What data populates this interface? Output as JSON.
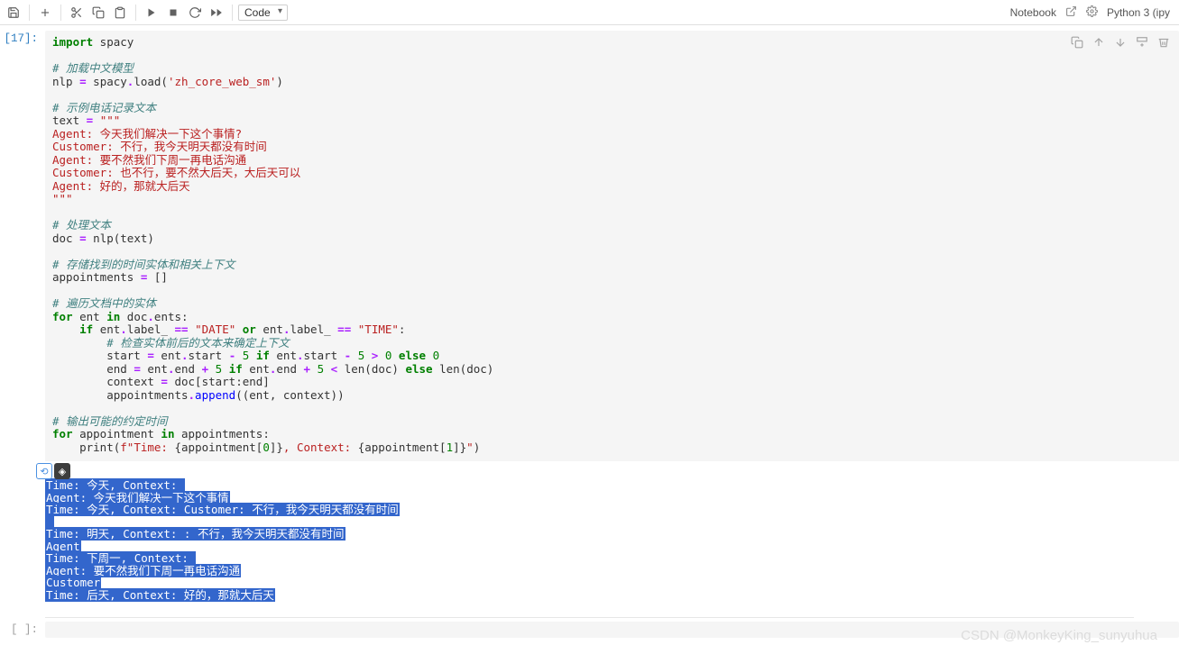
{
  "toolbar": {
    "cell_type": "Code",
    "notebook_label": "Notebook",
    "kernel_label": "Python 3 (ipy"
  },
  "cell": {
    "execution_count": "[17]:",
    "code_tokens": [
      [
        {
          "t": "kw",
          "v": "import"
        },
        {
          "t": "n",
          "v": " spacy"
        }
      ],
      [],
      [
        {
          "t": "c",
          "v": "# 加载中文模型"
        }
      ],
      [
        {
          "t": "n",
          "v": "nlp "
        },
        {
          "t": "op",
          "v": "="
        },
        {
          "t": "n",
          "v": " spacy"
        },
        {
          "t": "op",
          "v": "."
        },
        {
          "t": "n",
          "v": "load("
        },
        {
          "t": "s",
          "v": "'zh_core_web_sm'"
        },
        {
          "t": "n",
          "v": ")"
        }
      ],
      [],
      [
        {
          "t": "c",
          "v": "# 示例电话记录文本"
        }
      ],
      [
        {
          "t": "n",
          "v": "text "
        },
        {
          "t": "op",
          "v": "="
        },
        {
          "t": "n",
          "v": " "
        },
        {
          "t": "s",
          "v": "\"\"\""
        }
      ],
      [
        {
          "t": "s",
          "v": "Agent: 今天我们解决一下这个事情?"
        }
      ],
      [
        {
          "t": "s",
          "v": "Customer: 不行，我今天明天都没有时间"
        }
      ],
      [
        {
          "t": "s",
          "v": "Agent: 要不然我们下周一再电话沟通"
        }
      ],
      [
        {
          "t": "s",
          "v": "Customer: 也不行，要不然大后天，大后天可以"
        }
      ],
      [
        {
          "t": "s",
          "v": "Agent: 好的，那就大后天"
        }
      ],
      [
        {
          "t": "s",
          "v": "\"\"\""
        }
      ],
      [],
      [
        {
          "t": "c",
          "v": "# 处理文本"
        }
      ],
      [
        {
          "t": "n",
          "v": "doc "
        },
        {
          "t": "op",
          "v": "="
        },
        {
          "t": "n",
          "v": " nlp(text)"
        }
      ],
      [],
      [
        {
          "t": "c",
          "v": "# 存储找到的时间实体和相关上下文"
        }
      ],
      [
        {
          "t": "n",
          "v": "appointments "
        },
        {
          "t": "op",
          "v": "="
        },
        {
          "t": "n",
          "v": " []"
        }
      ],
      [],
      [
        {
          "t": "c",
          "v": "# 遍历文档中的实体"
        }
      ],
      [
        {
          "t": "kw",
          "v": "for"
        },
        {
          "t": "n",
          "v": " ent "
        },
        {
          "t": "kw",
          "v": "in"
        },
        {
          "t": "n",
          "v": " doc"
        },
        {
          "t": "op",
          "v": "."
        },
        {
          "t": "n",
          "v": "ents:"
        }
      ],
      [
        {
          "t": "n",
          "v": "    "
        },
        {
          "t": "kw",
          "v": "if"
        },
        {
          "t": "n",
          "v": " ent"
        },
        {
          "t": "op",
          "v": "."
        },
        {
          "t": "n",
          "v": "label_ "
        },
        {
          "t": "op",
          "v": "=="
        },
        {
          "t": "n",
          "v": " "
        },
        {
          "t": "s",
          "v": "\"DATE\""
        },
        {
          "t": "n",
          "v": " "
        },
        {
          "t": "kw",
          "v": "or"
        },
        {
          "t": "n",
          "v": " ent"
        },
        {
          "t": "op",
          "v": "."
        },
        {
          "t": "n",
          "v": "label_ "
        },
        {
          "t": "op",
          "v": "=="
        },
        {
          "t": "n",
          "v": " "
        },
        {
          "t": "s",
          "v": "\"TIME\""
        },
        {
          "t": "n",
          "v": ":"
        }
      ],
      [
        {
          "t": "n",
          "v": "        "
        },
        {
          "t": "c",
          "v": "# 检查实体前后的文本来确定上下文"
        }
      ],
      [
        {
          "t": "n",
          "v": "        start "
        },
        {
          "t": "op",
          "v": "="
        },
        {
          "t": "n",
          "v": " ent"
        },
        {
          "t": "op",
          "v": "."
        },
        {
          "t": "n",
          "v": "start "
        },
        {
          "t": "op",
          "v": "-"
        },
        {
          "t": "n",
          "v": " "
        },
        {
          "t": "num",
          "v": "5"
        },
        {
          "t": "n",
          "v": " "
        },
        {
          "t": "kw",
          "v": "if"
        },
        {
          "t": "n",
          "v": " ent"
        },
        {
          "t": "op",
          "v": "."
        },
        {
          "t": "n",
          "v": "start "
        },
        {
          "t": "op",
          "v": "-"
        },
        {
          "t": "n",
          "v": " "
        },
        {
          "t": "num",
          "v": "5"
        },
        {
          "t": "n",
          "v": " "
        },
        {
          "t": "op",
          "v": ">"
        },
        {
          "t": "n",
          "v": " "
        },
        {
          "t": "num",
          "v": "0"
        },
        {
          "t": "n",
          "v": " "
        },
        {
          "t": "kw",
          "v": "else"
        },
        {
          "t": "n",
          "v": " "
        },
        {
          "t": "num",
          "v": "0"
        }
      ],
      [
        {
          "t": "n",
          "v": "        end "
        },
        {
          "t": "op",
          "v": "="
        },
        {
          "t": "n",
          "v": " ent"
        },
        {
          "t": "op",
          "v": "."
        },
        {
          "t": "n",
          "v": "end "
        },
        {
          "t": "op",
          "v": "+"
        },
        {
          "t": "n",
          "v": " "
        },
        {
          "t": "num",
          "v": "5"
        },
        {
          "t": "n",
          "v": " "
        },
        {
          "t": "kw",
          "v": "if"
        },
        {
          "t": "n",
          "v": " ent"
        },
        {
          "t": "op",
          "v": "."
        },
        {
          "t": "n",
          "v": "end "
        },
        {
          "t": "op",
          "v": "+"
        },
        {
          "t": "n",
          "v": " "
        },
        {
          "t": "num",
          "v": "5"
        },
        {
          "t": "n",
          "v": " "
        },
        {
          "t": "op",
          "v": "<"
        },
        {
          "t": "n",
          "v": " len(doc) "
        },
        {
          "t": "kw",
          "v": "else"
        },
        {
          "t": "n",
          "v": " len(doc)"
        }
      ],
      [
        {
          "t": "n",
          "v": "        context "
        },
        {
          "t": "op",
          "v": "="
        },
        {
          "t": "n",
          "v": " doc[start:end]"
        }
      ],
      [
        {
          "t": "n",
          "v": "        appointments"
        },
        {
          "t": "op",
          "v": "."
        },
        {
          "t": "fn",
          "v": "append"
        },
        {
          "t": "n",
          "v": "((ent, context))"
        }
      ],
      [],
      [
        {
          "t": "c",
          "v": "# 输出可能的约定时间"
        }
      ],
      [
        {
          "t": "kw",
          "v": "for"
        },
        {
          "t": "n",
          "v": " appointment "
        },
        {
          "t": "kw",
          "v": "in"
        },
        {
          "t": "n",
          "v": " appointments:"
        }
      ],
      [
        {
          "t": "n",
          "v": "    print("
        },
        {
          "t": "s",
          "v": "f\"Time: "
        },
        {
          "t": "n",
          "v": "{"
        },
        {
          "t": "n",
          "v": "appointment["
        },
        {
          "t": "num",
          "v": "0"
        },
        {
          "t": "n",
          "v": "]"
        },
        {
          "t": "n",
          "v": "}"
        },
        {
          "t": "s",
          "v": ", Context: "
        },
        {
          "t": "n",
          "v": "{"
        },
        {
          "t": "n",
          "v": "appointment["
        },
        {
          "t": "num",
          "v": "1"
        },
        {
          "t": "n",
          "v": "]"
        },
        {
          "t": "n",
          "v": "}"
        },
        {
          "t": "s",
          "v": "\""
        },
        {
          "t": "n",
          "v": ")"
        }
      ]
    ]
  },
  "output_lines": [
    "Time: 今天, Context: ",
    "Agent: 今天我们解决一下这个事情",
    "Time: 今天, Context: Customer: 不行，我今天明天都没有时间",
    " ",
    "Time: 明天, Context: : 不行，我今天明天都没有时间",
    "Agent",
    "Time: 下周一, Context: ",
    "Agent: 要不然我们下周一再电话沟通",
    "Customer",
    "Time: 后天, Context: 好的，那就大后天"
  ],
  "empty_prompt": "[ ]:",
  "watermark": "CSDN @MonkeyKing_sunyuhua"
}
